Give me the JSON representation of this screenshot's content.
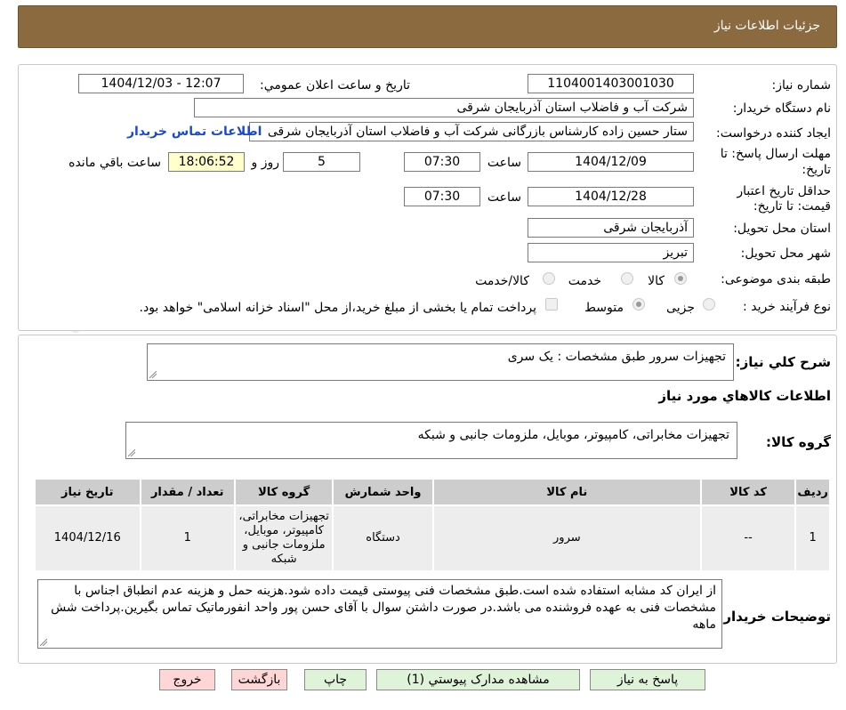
{
  "header": {
    "title": "جزئیات اطلاعات نیاز"
  },
  "fields": {
    "need_number_label": "شماره نیاز:",
    "need_number": "1104001403001030",
    "announce_label": "تاریخ و ساعت اعلان عمومي:",
    "announce_value": "1404/12/03 - 12:07",
    "buyer_label": "نام دستگاه خریدار:",
    "buyer_value": "شرکت آب و فاضلاب استان آذربایجان شرقی",
    "creator_label": "ایجاد کننده درخواست:",
    "creator_value": "ستار حسین زاده کارشناس بازرگانی شرکت آب و فاضلاب استان آذربایجان شرقی",
    "contact_link": "اطلاعات تماس خریدار",
    "deadline_label_1": "مهلت ارسال پاسخ: تا",
    "deadline_label_2": "تاریخ:",
    "deadline_date": "1404/12/09",
    "time_label": "ساعت",
    "deadline_time": "07:30",
    "days_value": "5",
    "days_label": "روز و",
    "remaining_time": "18:06:52",
    "remaining_label": "ساعت باقي مانده",
    "validity_label_1": "حداقل تاریخ اعتبار",
    "validity_label_2": "قیمت: تا تاریخ:",
    "validity_date": "1404/12/28",
    "validity_time": "07:30",
    "province_label": "استان محل تحویل:",
    "province_value": "آذربایجان شرقی",
    "city_label": "شهر محل تحویل:",
    "city_value": "تبریز",
    "category_label": "طبقه بندی موضوعی:",
    "category_options": [
      "کالا",
      "خدمت",
      "کالا/خدمت"
    ],
    "category_selected": "کالا",
    "process_label": "نوع فرآیند خرید :",
    "process_options": [
      "جزیی",
      "متوسط"
    ],
    "process_selected": "متوسط",
    "treasury_note": "پرداخت تمام یا بخشی از مبلغ خرید،از محل \"اسناد خزانه اسلامی\" خواهد بود."
  },
  "summary": {
    "description_label": "شرح کلي نیاز:",
    "description_value": "تجهیزات سرور طبق مشخصات : یک سری",
    "goods_info_title": "اطلاعات کالاهاي مورد نیاز",
    "goods_group_label": "گروه کالا:",
    "goods_group_value": "تجهیزات مخابراتی، کامپیوتر، موبایل، ملزومات جانبی و شبکه"
  },
  "table": {
    "headers": [
      "ردیف",
      "کد کالا",
      "نام کالا",
      "واحد شمارش",
      "گروه کالا",
      "تعداد / مقدار",
      "تاریخ نیاز"
    ],
    "rows": [
      [
        "1",
        "--",
        "سرور",
        "دستگاه",
        "تجهیزات مخابراتی، کامپیوتر، موبایل، ملزومات جانبی و شبکه",
        "1",
        "1404/12/16"
      ]
    ]
  },
  "buyer_notes": {
    "label": "توضیحات خریدار:",
    "value": "از ایران کد مشابه استفاده شده است.طبق مشخصات فنی پیوستی قیمت داده شود.هزینه حمل و هزینه عدم انطباق اجناس با مشخصات فنی به عهده فروشنده می باشد.در صورت داشتن سوال با آقای حسن پور واحد انفورماتیک تماس بگیرین.پرداخت شش ماهه"
  },
  "buttons": {
    "reply": "پاسخ به نیاز",
    "attachments": "مشاهده مدارک پیوستي (1)",
    "print": "چاپ",
    "back": "بازگشت",
    "exit": "خروج"
  },
  "watermark": {
    "text": "AriaTender.neT"
  },
  "colors": {
    "header": "#8b6a40",
    "link": "#1a49c9",
    "button_green": "#dff3d8",
    "button_pink": "#ffd6d6"
  }
}
